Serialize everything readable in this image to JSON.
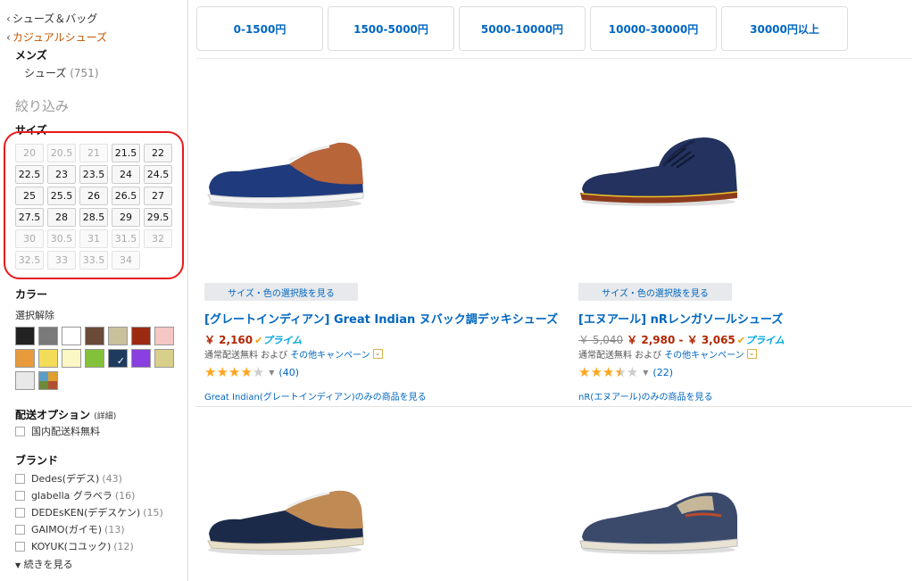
{
  "breadcrumbs": [
    {
      "label": "シューズ＆バッグ"
    },
    {
      "label": "カジュアルシューズ"
    }
  ],
  "department": {
    "title": "メンズ",
    "category": "シューズ",
    "count": "(751)"
  },
  "refine_title": "絞り込み",
  "size_filter": {
    "title": "サイズ",
    "sizes": [
      {
        "label": "20",
        "enabled": false
      },
      {
        "label": "20.5",
        "enabled": false
      },
      {
        "label": "21",
        "enabled": false
      },
      {
        "label": "21.5",
        "enabled": true
      },
      {
        "label": "22",
        "enabled": true
      },
      {
        "label": "22.5",
        "enabled": true
      },
      {
        "label": "23",
        "enabled": true
      },
      {
        "label": "23.5",
        "enabled": true
      },
      {
        "label": "24",
        "enabled": true
      },
      {
        "label": "24.5",
        "enabled": true
      },
      {
        "label": "25",
        "enabled": true
      },
      {
        "label": "25.5",
        "enabled": true
      },
      {
        "label": "26",
        "enabled": true
      },
      {
        "label": "26.5",
        "enabled": true
      },
      {
        "label": "27",
        "enabled": true
      },
      {
        "label": "27.5",
        "enabled": true
      },
      {
        "label": "28",
        "enabled": true
      },
      {
        "label": "28.5",
        "enabled": true
      },
      {
        "label": "29",
        "enabled": true
      },
      {
        "label": "29.5",
        "enabled": true
      },
      {
        "label": "30",
        "enabled": false
      },
      {
        "label": "30.5",
        "enabled": false
      },
      {
        "label": "31",
        "enabled": false
      },
      {
        "label": "31.5",
        "enabled": false
      },
      {
        "label": "32",
        "enabled": false
      },
      {
        "label": "32.5",
        "enabled": false
      },
      {
        "label": "33",
        "enabled": false
      },
      {
        "label": "33.5",
        "enabled": false
      },
      {
        "label": "34",
        "enabled": false
      }
    ],
    "highlight_color": "#e8191c"
  },
  "color_filter": {
    "title": "カラー",
    "deselect": "選択解除",
    "swatches": [
      {
        "color": "#222222"
      },
      {
        "color": "#7a7a7a"
      },
      {
        "color": "#ffffff"
      },
      {
        "color": "#6b4a3a"
      },
      {
        "color": "#c9c19b"
      },
      {
        "color": "#9c2a12"
      },
      {
        "color": "#f4c6c4"
      },
      {
        "color": "#e89a3c"
      },
      {
        "color": "#f3dc58"
      },
      {
        "color": "#fbf8c6"
      },
      {
        "color": "#84c13a"
      },
      {
        "color": "#1e3a5f",
        "selected": true
      },
      {
        "color": "#8a3fe0"
      },
      {
        "color": "#d8cf8a"
      },
      {
        "color": "#e8e8e8"
      },
      {
        "multi": [
          "#5a9ec8",
          "#e0a030",
          "#6b8a3a",
          "#b05030"
        ]
      }
    ]
  },
  "shipping_filter": {
    "title": "配送オプション",
    "detail": "(詳細)",
    "option": "国内配送料無料"
  },
  "brand_filter": {
    "title": "ブランド",
    "brands": [
      {
        "name": "Dedes(デデス)",
        "count": "(43)"
      },
      {
        "name": "glabella グラベラ",
        "count": "(16)"
      },
      {
        "name": "DEDEsKEN(デデスケン)",
        "count": "(15)"
      },
      {
        "name": "GAIMO(ガイモ)",
        "count": "(13)"
      },
      {
        "name": "KOYUK(コユック)",
        "count": "(12)"
      }
    ],
    "see_more": "続きを見る"
  },
  "price_tabs": [
    {
      "label": "0-1500円"
    },
    {
      "label": "1500-5000円"
    },
    {
      "label": "5000-10000円"
    },
    {
      "label": "10000-30000円"
    },
    {
      "label": "30000円以上"
    }
  ],
  "products": [
    {
      "options_button": "サイズ・色の選択肢を見る",
      "title": "[グレートインディアン] Great Indian ヌバック調デッキシューズ",
      "price": "￥ 2,160",
      "prime": "プライム",
      "shipping": "通常配送無料 および",
      "campaign": "その他キャンペーン",
      "rating": 4,
      "reviews": "(40)",
      "brand_link": "Great Indian(グレートインディアン)のみの商品を見る"
    },
    {
      "options_button": "サイズ・色の選択肢を見る",
      "title": "[エヌアール] nRレンガソールシューズ",
      "list_price": "￥ 5,040",
      "price": "￥ 2,980 - ￥ 3,065",
      "prime": "プライム",
      "shipping": "通常配送無料 および",
      "campaign": "その他キャンペーン",
      "rating": 3.5,
      "reviews": "(22)",
      "brand_link": "nR(エヌアール)のみの商品を見る"
    }
  ]
}
